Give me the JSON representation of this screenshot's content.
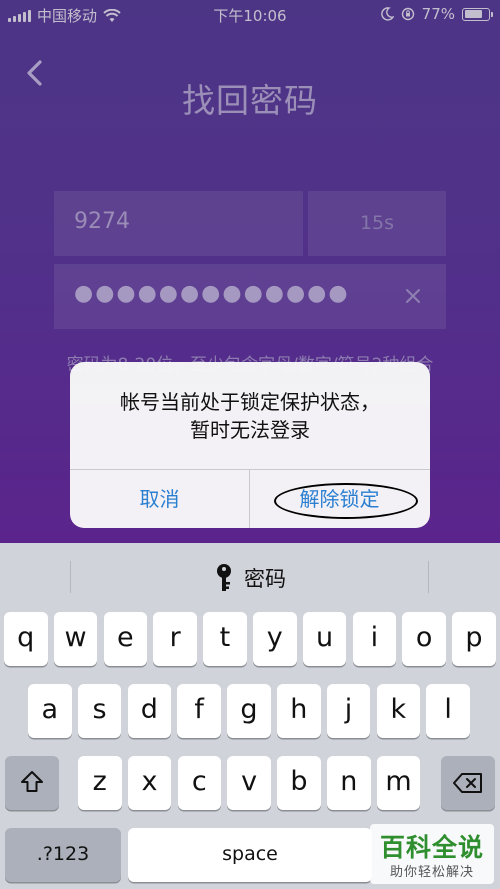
{
  "status_bar": {
    "carrier": "中国移动",
    "time": "下午10:06",
    "battery_percent": "77%",
    "battery_level": 0.77
  },
  "header": {
    "title": "找回密码"
  },
  "form": {
    "code_value": "9274",
    "countdown": "15s",
    "password_masked": "●●●●●●●●●●●●●",
    "hint": "密码为8-20位，至少包含字母/数字/符号2种组合"
  },
  "alert": {
    "line1": "帐号当前处于锁定保护状态，",
    "line2": "暂时无法登录",
    "cancel_label": "取消",
    "unlock_label": "解除锁定"
  },
  "keyboard": {
    "suggestion": "密码",
    "row1": [
      "q",
      "w",
      "e",
      "r",
      "t",
      "y",
      "u",
      "i",
      "o",
      "p"
    ],
    "row2": [
      "a",
      "s",
      "d",
      "f",
      "g",
      "h",
      "j",
      "k",
      "l"
    ],
    "row3": [
      "z",
      "x",
      "c",
      "v",
      "b",
      "n",
      "m"
    ],
    "numbers_label": ".?123",
    "space_label": "space"
  },
  "watermark": {
    "title": "百科全说",
    "subtitle": "助你轻松解决"
  },
  "colors": {
    "accent_blue": "#2b7fd1",
    "bg_purple": "#5e3aa0"
  }
}
